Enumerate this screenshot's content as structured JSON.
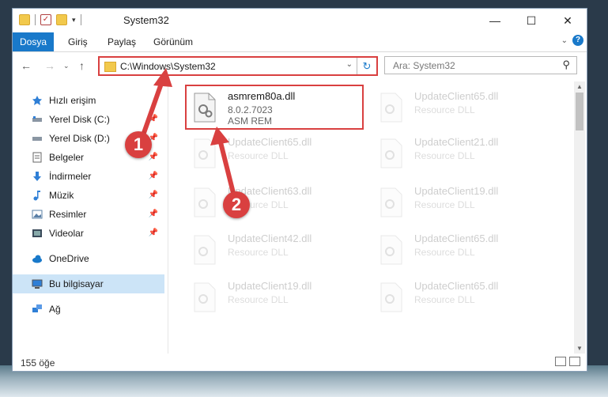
{
  "window": {
    "title": "System32"
  },
  "ribbon": {
    "tabs": [
      {
        "label": "Dosya",
        "active": true
      },
      {
        "label": "Giriş",
        "active": false
      },
      {
        "label": "Paylaş",
        "active": false
      },
      {
        "label": "Görünüm",
        "active": false
      }
    ]
  },
  "address": {
    "path": "C:\\Windows\\System32"
  },
  "search": {
    "placeholder": "Ara: System32"
  },
  "sidebar": {
    "items": [
      {
        "label": "Hızlı erişim",
        "icon": "star-icon",
        "pinned": false
      },
      {
        "label": "Yerel Disk (C:)",
        "icon": "drive-icon",
        "pinned": true
      },
      {
        "label": "Yerel Disk (D:)",
        "icon": "drive-icon",
        "pinned": true
      },
      {
        "label": "Belgeler",
        "icon": "documents-icon",
        "pinned": true
      },
      {
        "label": "İndirmeler",
        "icon": "download-icon",
        "pinned": true
      },
      {
        "label": "Müzik",
        "icon": "music-icon",
        "pinned": true
      },
      {
        "label": "Resimler",
        "icon": "pictures-icon",
        "pinned": true
      },
      {
        "label": "Videolar",
        "icon": "videos-icon",
        "pinned": true
      },
      {
        "label": "OneDrive",
        "icon": "cloud-icon",
        "pinned": false
      },
      {
        "label": "Bu bilgisayar",
        "icon": "computer-icon",
        "pinned": false,
        "selected": true
      },
      {
        "label": "Ağ",
        "icon": "network-icon",
        "pinned": false
      }
    ]
  },
  "files": [
    {
      "name": "asmrem80a.dll",
      "version": "8.0.2.7023",
      "desc": "ASM REM",
      "highlighted": true
    },
    {
      "name": "UpdateClient65.dll",
      "desc": "Resource DLL"
    },
    {
      "name": "UpdateClient65.dll",
      "desc": "Resource DLL"
    },
    {
      "name": "UpdateClient21.dll",
      "desc": "Resource DLL"
    },
    {
      "name": "UpdateClient63.dll",
      "desc": "Resource DLL"
    },
    {
      "name": "UpdateClient19.dll",
      "desc": "Resource DLL"
    },
    {
      "name": "UpdateClient42.dll",
      "desc": "Resource DLL"
    },
    {
      "name": "UpdateClient65.dll",
      "desc": "Resource DLL"
    },
    {
      "name": "UpdateClient19.dll",
      "desc": "Resource DLL"
    },
    {
      "name": "UpdateClient65.dll",
      "desc": "Resource DLL"
    }
  ],
  "status": {
    "count": "155 öğe"
  },
  "annotations": {
    "step1": "1",
    "step2": "2"
  }
}
